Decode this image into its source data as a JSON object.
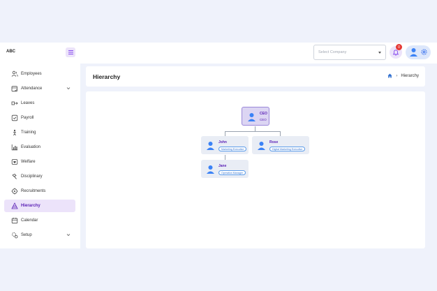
{
  "brand": "ABC",
  "company_select": {
    "placeholder": "Select Company"
  },
  "notifications": {
    "count": "0"
  },
  "sidebar": {
    "items": [
      {
        "label": "Employees",
        "icon": "users-icon"
      },
      {
        "label": "Attendance",
        "icon": "calendar-check-icon",
        "expandable": true
      },
      {
        "label": "Leaves",
        "icon": "leave-icon"
      },
      {
        "label": "Payroll",
        "icon": "payroll-icon"
      },
      {
        "label": "Training",
        "icon": "training-icon"
      },
      {
        "label": "Evaluation",
        "icon": "chart-icon"
      },
      {
        "label": "Welfare",
        "icon": "welfare-icon"
      },
      {
        "label": "Disciplinary",
        "icon": "disciplinary-icon"
      },
      {
        "label": "Recruitments",
        "icon": "recruit-icon"
      },
      {
        "label": "Hierarchy",
        "icon": "hierarchy-icon",
        "active": true
      },
      {
        "label": "Calendar",
        "icon": "calendar-icon"
      },
      {
        "label": "Setup",
        "icon": "setup-icon",
        "expandable": true
      }
    ]
  },
  "page": {
    "title": "Hierarchy",
    "breadcrumb": {
      "current": "Hierarchy"
    }
  },
  "org_chart": {
    "root": {
      "name": "CEO",
      "role": "CEO"
    },
    "children": [
      {
        "name": "John",
        "role": "Marketing Executive",
        "children": [
          {
            "name": "Jane",
            "role": "Operation Manager"
          }
        ]
      },
      {
        "name": "Rose",
        "role": "Digital Marketing Executive"
      }
    ]
  },
  "colors": {
    "accent": "#5b21b6",
    "active_bg": "#ece3fa",
    "badge": "#e53935",
    "page_bg": "#eff2fb",
    "blue": "#2f6fcf"
  }
}
